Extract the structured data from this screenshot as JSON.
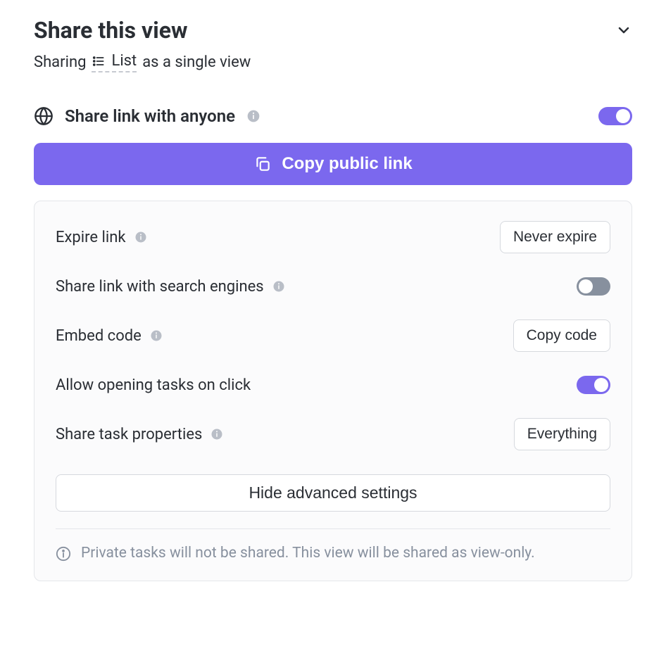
{
  "header": {
    "title": "Share this view"
  },
  "subheader": {
    "prefix": "Sharing",
    "viewName": "List",
    "suffix": "as a single view"
  },
  "shareLink": {
    "label": "Share link with anyone",
    "enabled": true
  },
  "copyButton": {
    "label": "Copy public link"
  },
  "settings": {
    "expireLink": {
      "label": "Expire link",
      "buttonLabel": "Never expire"
    },
    "searchEngines": {
      "label": "Share link with search engines",
      "enabled": false
    },
    "embedCode": {
      "label": "Embed code",
      "buttonLabel": "Copy code"
    },
    "allowOpening": {
      "label": "Allow opening tasks on click",
      "enabled": true
    },
    "taskProperties": {
      "label": "Share task properties",
      "buttonLabel": "Everything"
    },
    "hideAdvanced": "Hide advanced settings",
    "footerNote": "Private tasks will not be shared. This view will be shared as view-only."
  }
}
